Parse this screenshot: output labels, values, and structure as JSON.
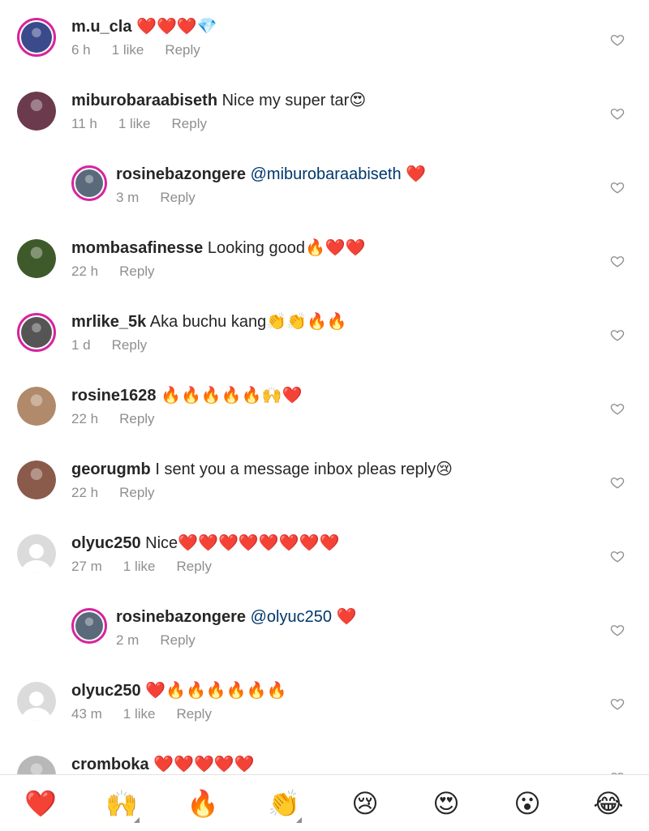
{
  "comments": [
    {
      "username": "m.u_cla",
      "text": "❤️❤️❤️💎",
      "mention": "",
      "time": "6 h",
      "likes": "1 like",
      "reply": "Reply",
      "avatar_color": "#3a4a8a",
      "story_ring": true,
      "reply_level": 0
    },
    {
      "username": "miburobaraabiseth",
      "text": "Nice my super tar😍",
      "mention": "",
      "time": "11 h",
      "likes": "1 like",
      "reply": "Reply",
      "avatar_color": "#6b3a4c",
      "story_ring": false,
      "reply_level": 0
    },
    {
      "username": "rosinebazongere",
      "text": "❤️",
      "mention": "@miburobaraabiseth",
      "time": "3 m",
      "likes": "",
      "reply": "Reply",
      "avatar_color": "#5a6a7a",
      "story_ring": true,
      "reply_level": 1
    },
    {
      "username": "mombasafinesse",
      "text": "Looking good🔥❤️❤️",
      "mention": "",
      "time": "22 h",
      "likes": "",
      "reply": "Reply",
      "avatar_color": "#3f5a2a",
      "story_ring": false,
      "reply_level": 0
    },
    {
      "username": "mrlike_5k",
      "text": "Aka buchu kang👏👏🔥🔥",
      "mention": "",
      "time": "1 d",
      "likes": "",
      "reply": "Reply",
      "avatar_color": "#555555",
      "story_ring": true,
      "reply_level": 0
    },
    {
      "username": "rosine1628",
      "text": "🔥🔥🔥🔥🔥🙌❤️",
      "mention": "",
      "time": "22 h",
      "likes": "",
      "reply": "Reply",
      "avatar_color": "#b08a6a",
      "story_ring": false,
      "reply_level": 0
    },
    {
      "username": "georugmb",
      "text": "I sent you a message inbox pleas reply😢",
      "mention": "",
      "time": "22 h",
      "likes": "",
      "reply": "Reply",
      "avatar_color": "#8a5a4a",
      "story_ring": false,
      "reply_level": 0
    },
    {
      "username": "olyuc250",
      "text": "Nice❤️❤️❤️❤️❤️❤️❤️❤️",
      "mention": "",
      "time": "27 m",
      "likes": "1 like",
      "reply": "Reply",
      "avatar_color": "",
      "story_ring": false,
      "reply_level": 0
    },
    {
      "username": "rosinebazongere",
      "text": "❤️",
      "mention": "@olyuc250",
      "time": "2 m",
      "likes": "",
      "reply": "Reply",
      "avatar_color": "#5a6a7a",
      "story_ring": true,
      "reply_level": 1
    },
    {
      "username": "olyuc250",
      "text": "❤️🔥🔥🔥🔥🔥🔥",
      "mention": "",
      "time": "43 m",
      "likes": "1 like",
      "reply": "Reply",
      "avatar_color": "",
      "story_ring": false,
      "reply_level": 0
    },
    {
      "username": "cromboka",
      "text": "❤️❤️❤️❤️❤️",
      "mention": "",
      "time": "",
      "likes": "",
      "reply": "",
      "avatar_color": "#b8b8b8",
      "story_ring": false,
      "reply_level": 0
    }
  ],
  "quick_reactions": [
    {
      "emoji": "❤️",
      "name": "heart",
      "tone": false
    },
    {
      "emoji": "🙌",
      "name": "raising-hands",
      "tone": true
    },
    {
      "emoji": "🔥",
      "name": "fire",
      "tone": false
    },
    {
      "emoji": "👏",
      "name": "clapping-hands",
      "tone": true
    },
    {
      "emoji": "😢",
      "name": "crying-face",
      "tone": false
    },
    {
      "emoji": "😍",
      "name": "heart-eyes",
      "tone": false
    },
    {
      "emoji": "😮",
      "name": "surprised-face",
      "tone": false
    },
    {
      "emoji": "😂",
      "name": "laughing-face",
      "tone": false
    }
  ]
}
